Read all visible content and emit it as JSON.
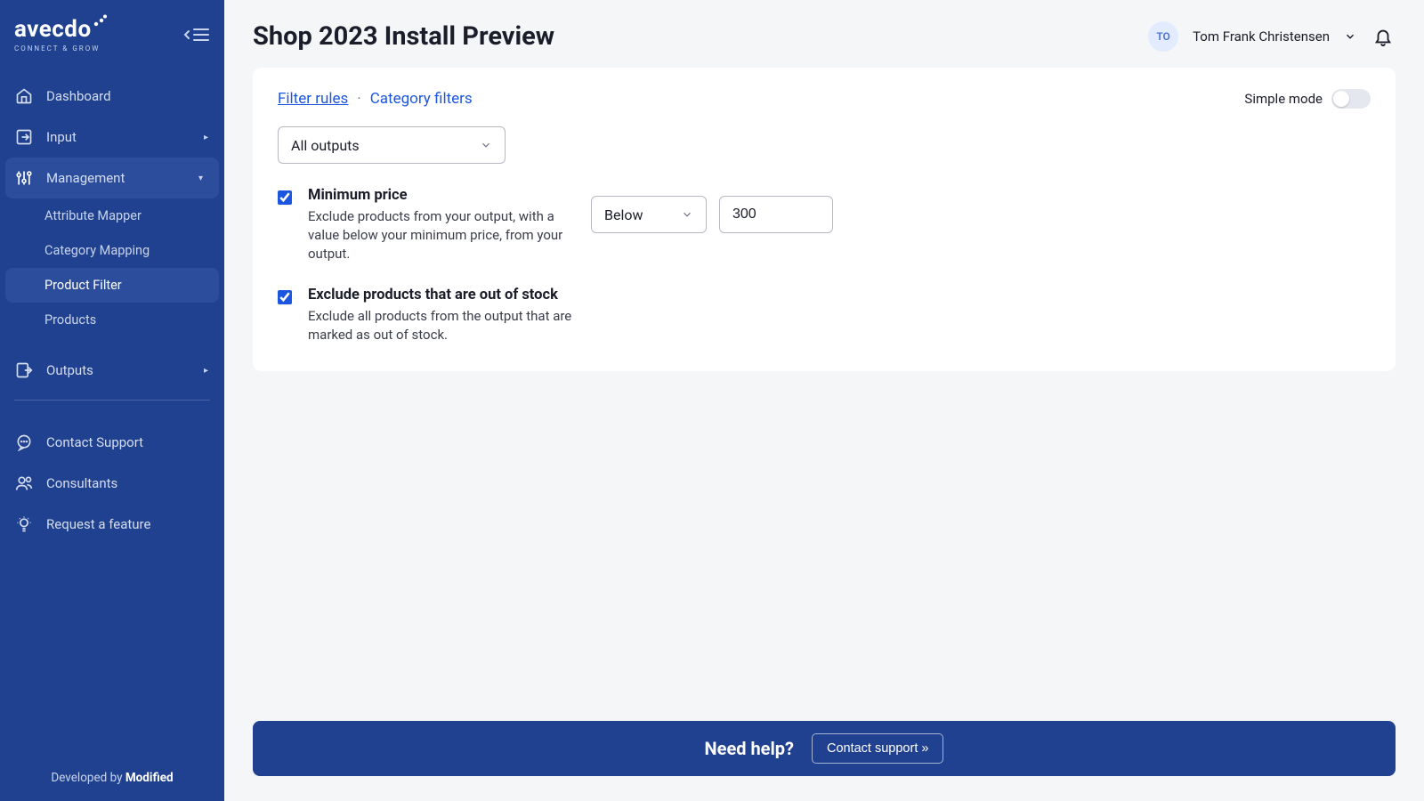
{
  "brand": {
    "name": "avecdo",
    "tagline": "CONNECT & GROW"
  },
  "sidebar": {
    "items": [
      {
        "label": "Dashboard"
      },
      {
        "label": "Input"
      },
      {
        "label": "Management"
      },
      {
        "label": "Outputs"
      }
    ],
    "management_sub": [
      {
        "label": "Attribute Mapper"
      },
      {
        "label": "Category Mapping"
      },
      {
        "label": "Product Filter"
      },
      {
        "label": "Products"
      }
    ],
    "support": [
      {
        "label": "Contact Support"
      },
      {
        "label": "Consultants"
      },
      {
        "label": "Request a feature"
      }
    ],
    "footer_prefix": "Developed by ",
    "footer_brand": "Modified"
  },
  "header": {
    "title": "Shop 2023 Install Preview",
    "user_initials": "TO",
    "user_name": "Tom Frank Christensen"
  },
  "tabs": {
    "filter_rules": "Filter rules",
    "separator": "·",
    "category_filters": "Category filters",
    "simple_mode_label": "Simple mode"
  },
  "output_select": {
    "value": "All outputs"
  },
  "rules": {
    "min_price": {
      "checked": true,
      "title": "Minimum price",
      "desc": "Exclude products from your output, with a value below your minimum price, from your output.",
      "operator": "Below",
      "value": "300"
    },
    "out_of_stock": {
      "checked": true,
      "title": "Exclude products that are out of stock",
      "desc": "Exclude all products from the output that are marked as out of stock."
    }
  },
  "help": {
    "text": "Need help?",
    "button": "Contact support »"
  }
}
